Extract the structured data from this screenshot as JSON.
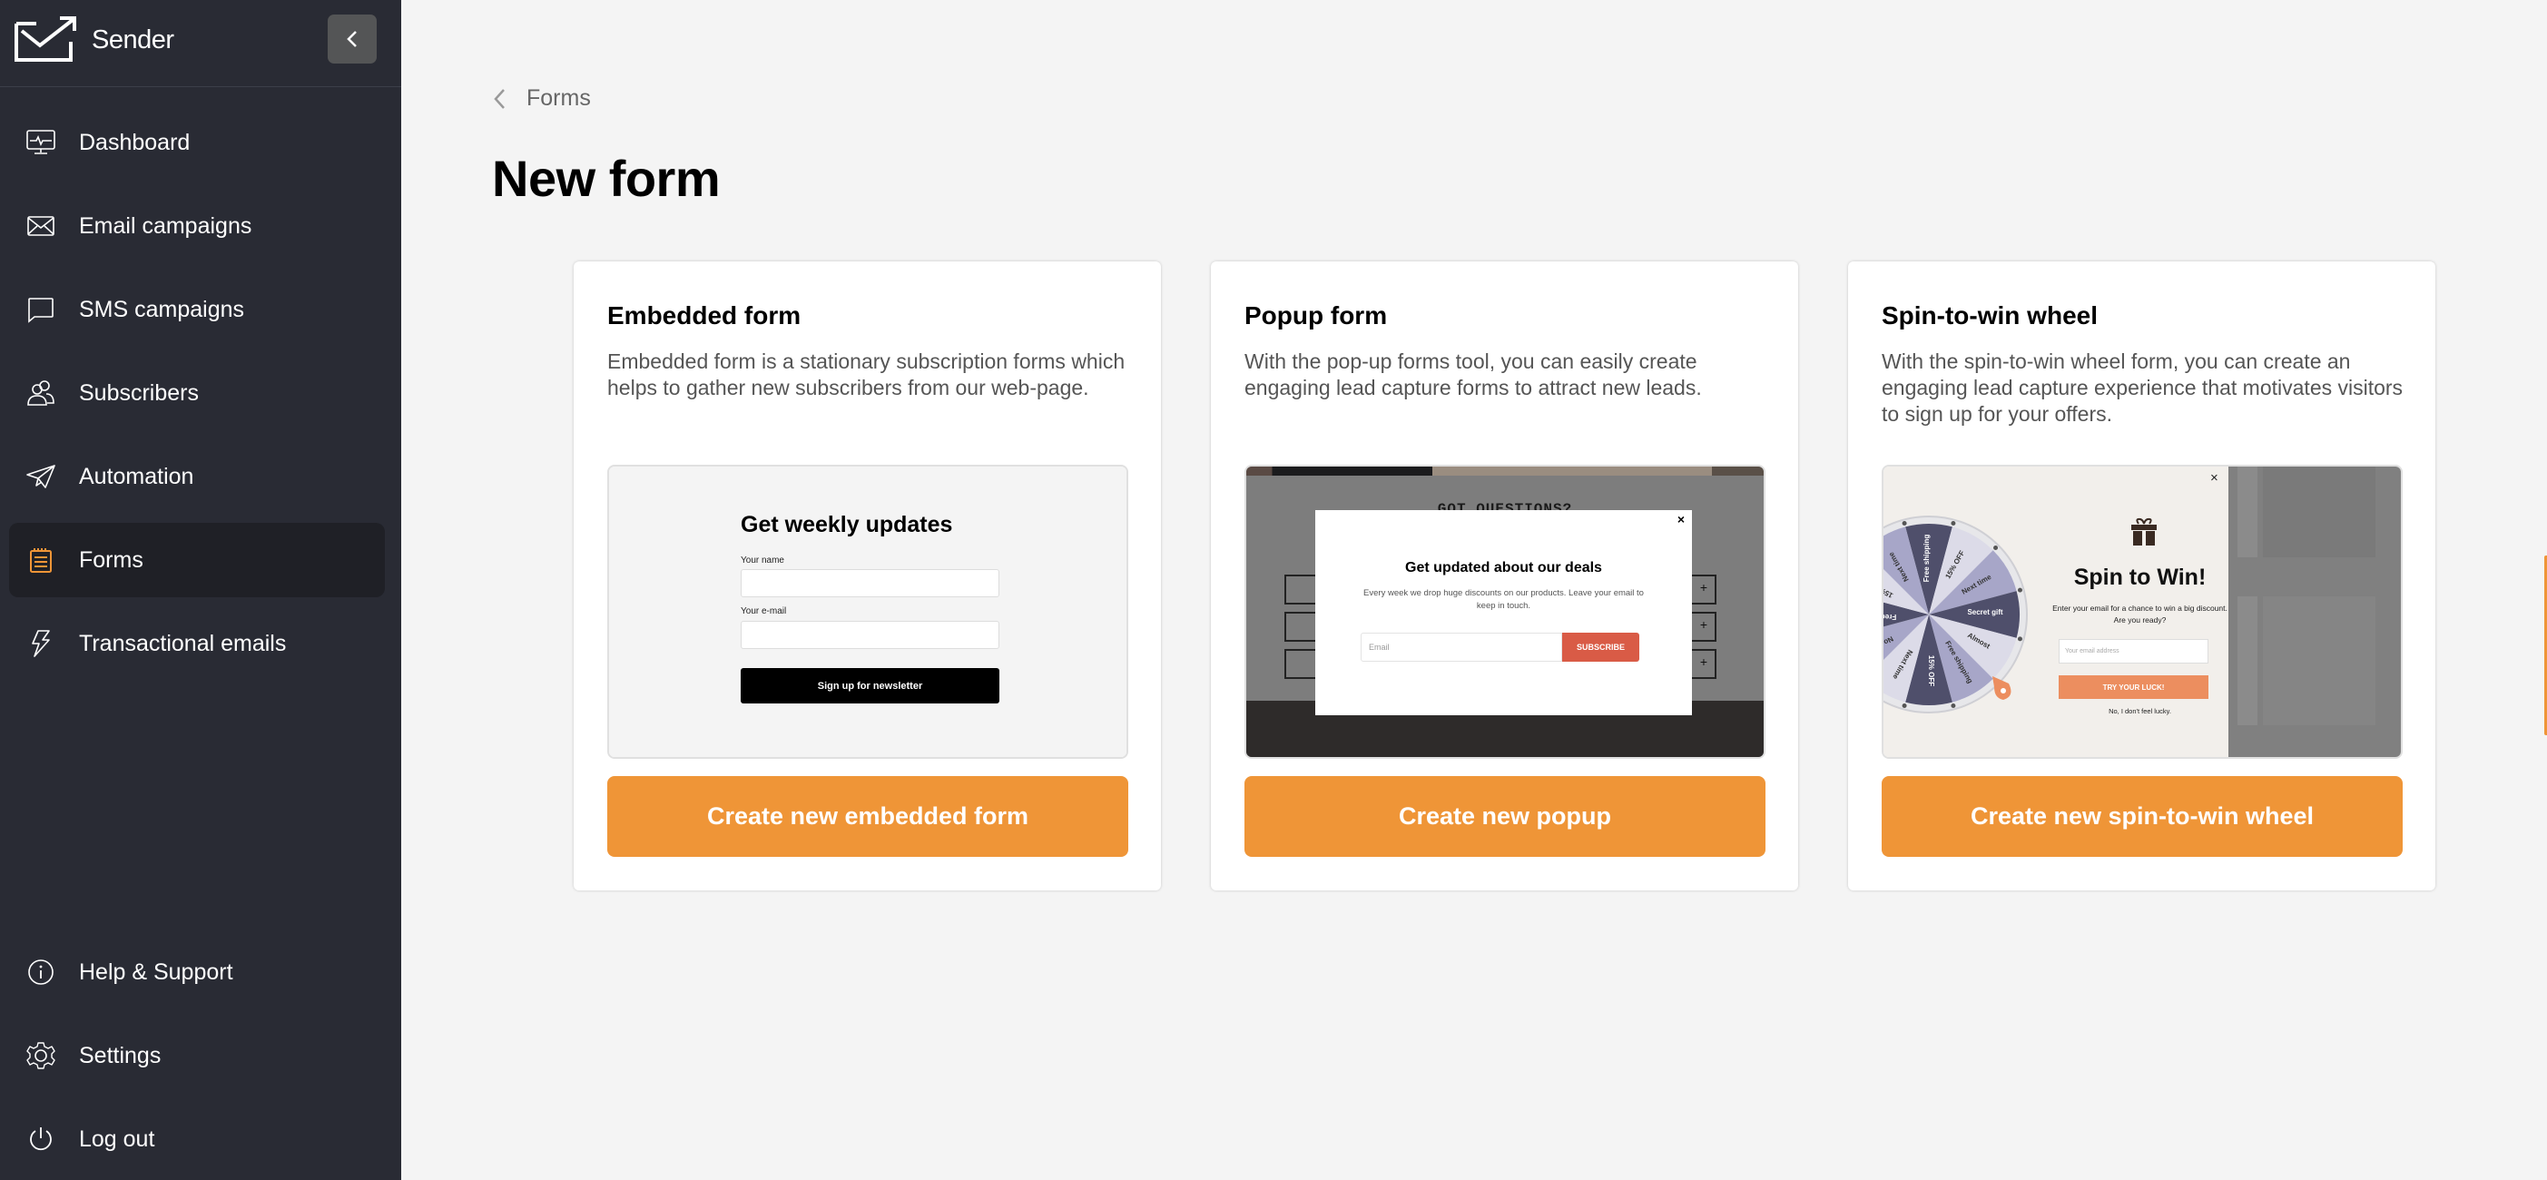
{
  "app": {
    "brand": "Sender",
    "accent_color": "#ef9537"
  },
  "sidebar": {
    "collapse_icon": "chevron-left-icon",
    "items": [
      {
        "label": "Dashboard",
        "icon": "monitor-pulse-icon",
        "active": false
      },
      {
        "label": "Email campaigns",
        "icon": "envelope-icon",
        "active": false
      },
      {
        "label": "SMS campaigns",
        "icon": "chat-bubble-icon",
        "active": false
      },
      {
        "label": "Subscribers",
        "icon": "users-icon",
        "active": false
      },
      {
        "label": "Automation",
        "icon": "paper-plane-icon",
        "active": false
      },
      {
        "label": "Forms",
        "icon": "notepad-icon",
        "active": true
      },
      {
        "label": "Transactional emails",
        "icon": "lightning-icon",
        "active": false
      }
    ],
    "bottom_items": [
      {
        "label": "Help & Support",
        "icon": "info-circle-icon"
      },
      {
        "label": "Settings",
        "icon": "gear-icon"
      },
      {
        "label": "Log out",
        "icon": "power-icon"
      }
    ]
  },
  "header": {
    "breadcrumb": "Forms",
    "title": "New form"
  },
  "cards": [
    {
      "title": "Embedded form",
      "description": "Embedded form is a stationary subscription forms which helps to gather new subscribers from our web-page.",
      "button": "Create new embedded form",
      "preview": {
        "heading": "Get weekly updates",
        "name_label": "Your name",
        "email_label": "Your e-mail",
        "submit": "Sign up for newsletter"
      }
    },
    {
      "title": "Popup form",
      "description": "With the pop-up forms tool, you can easily create engaging lead capture forms to attract new leads.",
      "button": "Create new popup",
      "preview": {
        "background_heading": "GOT QUESTIONS?",
        "close": "×",
        "heading": "Get updated about our deals",
        "text": "Every week we drop huge discounts on our products. Leave your email to keep in touch.",
        "email_placeholder": "Email",
        "submit": "SUBSCRIBE",
        "row_icon": "+"
      }
    },
    {
      "title": "Spin-to-win wheel",
      "description": "With the spin-to-win wheel form, you can create an engaging lead capture experience that motivates visitors to sign up for your offers.",
      "button": "Create new spin-to-win wheel",
      "preview": {
        "close": "×",
        "heading": "Spin to Win!",
        "text": "Enter your email for a chance to win a big discount. Are you ready?",
        "email_placeholder": "Your email address",
        "submit": "TRY YOUR LUCK!",
        "decline": "No, I don't feel lucky.",
        "wheel_segments": [
          "Free shipping",
          "15% OFF",
          "Next time",
          "Secret gift",
          "Almost",
          "Free shipping",
          "15% OFF",
          "Next time",
          "No luck"
        ]
      }
    }
  ]
}
